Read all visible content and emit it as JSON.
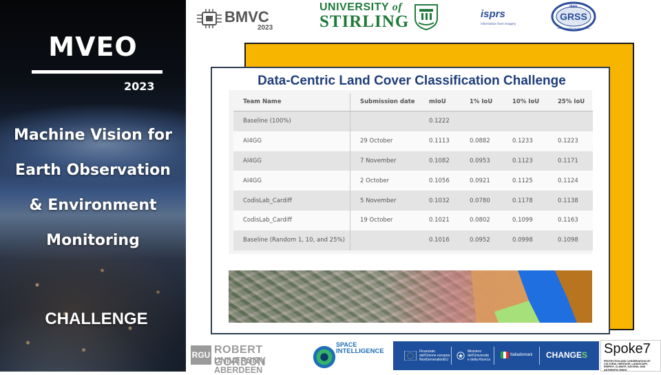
{
  "left_panel": {
    "title": "MVEO",
    "year": "2023",
    "subtitle_lines": [
      "Machine Vision for",
      "Earth Observation",
      "& Environment",
      "Monitoring"
    ],
    "challenge": "CHALLENGE"
  },
  "logos": {
    "bmvc": {
      "name": "BMVC",
      "year": "2023"
    },
    "stirling": {
      "line1_prefix": "UNIVERSITY",
      "line1_of": "of",
      "line2": "STIRLING"
    },
    "isprs": {
      "name": "isprs",
      "tagline": "information from imagery"
    },
    "grss": {
      "name": "GRSS",
      "ring_top": "IEEE",
      "ring_text": "Geoscience and Remote Sensing Society"
    },
    "rgu": {
      "mark": "RGU",
      "line1": "ROBERT GORDON",
      "line2": "UNIVERSITY ABERDEEN"
    },
    "space_intelligence": {
      "line1": "SPACE",
      "line2": "INTELLIGENCE"
    },
    "eu_banner": {
      "funded": [
        "Finanziato",
        "dall'Unione europea",
        "NextGenerationEU"
      ],
      "ministry": [
        "Ministero",
        "dell'Università",
        "e della Ricerca"
      ],
      "italia": "Italiadomani",
      "change_prefix": "CHANGE",
      "change_suffix": "S"
    },
    "spoke7": {
      "name": "Spoke7",
      "tagline": "PROTECTION AND CONSERVATION OF CULTURAL HERITAGE, LANDSCAPE, ENERGY, CLIMATE, NATURAL AND ANTHROPIC RISKS"
    }
  },
  "slide": {
    "title": "Data-Centric Land Cover Classification Challenge",
    "columns": [
      "Team Name",
      "Submission date",
      "mIoU",
      "1% IoU",
      "10% IoU",
      "25% IoU"
    ],
    "rows": [
      [
        "Baseline (100%)",
        "",
        "0.1222",
        "",
        "",
        ""
      ],
      [
        "AI4GG",
        "29 October",
        "0.1113",
        "0.0882",
        "0.1233",
        "0.1223"
      ],
      [
        "AI4GG",
        "7 November",
        "0.1082",
        "0.0953",
        "0.1123",
        "0.1171"
      ],
      [
        "AI4GG",
        "2 October",
        "0.1056",
        "0.0921",
        "0.1125",
        "0.1124"
      ],
      [
        "CodisLab_Cardiff",
        "5 November",
        "0.1032",
        "0.0780",
        "0.1178",
        "0.1138"
      ],
      [
        "CodisLab_Cardiff",
        "19 October",
        "0.1021",
        "0.0802",
        "0.1099",
        "0.1163"
      ],
      [
        "Baseline (Random 1, 10, and 25%)",
        "",
        "0.1016",
        "0.0952",
        "0.0998",
        "0.1098"
      ]
    ]
  },
  "colors": {
    "frame_orange": "#f7b500",
    "title_blue": "#1f3d7a",
    "stirling_green": "#1f7a3a",
    "eu_blue": "#1d4f9c",
    "landcover_tan": "#d99a5e",
    "landcover_blue": "#1f6fe0",
    "landcover_green": "#a6e07a",
    "landcover_brown": "#b8741f"
  }
}
